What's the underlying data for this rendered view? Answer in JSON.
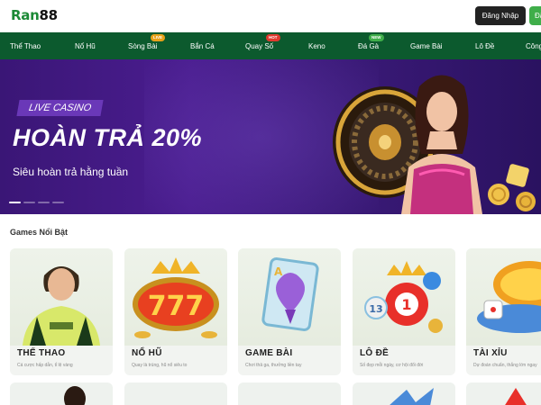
{
  "header": {
    "logo_text": "Ran",
    "logo_num": "88",
    "login_label": "Đăng Nhập",
    "register_label": "Đăng Ký"
  },
  "nav": {
    "items": [
      {
        "label": "Thể Thao",
        "badge": null
      },
      {
        "label": "Nổ Hũ",
        "badge": null
      },
      {
        "label": "Sòng Bài",
        "badge": "LIVE"
      },
      {
        "label": "Bắn Cá",
        "badge": null
      },
      {
        "label": "Quay Số",
        "badge": "HOT"
      },
      {
        "label": "Keno",
        "badge": null
      },
      {
        "label": "Đá Gà",
        "badge": "NEW"
      },
      {
        "label": "Game Bài",
        "badge": null
      },
      {
        "label": "Lô Đề",
        "badge": null
      },
      {
        "label": "Công",
        "badge": null
      }
    ]
  },
  "banner": {
    "tag": "LIVE CASINO",
    "title": "HOÀN TRẢ 20%",
    "subtitle": "Siêu hoàn trả hằng tuần",
    "slide_count": 4,
    "active_slide": 1
  },
  "section": {
    "title": "Games Nổi Bật"
  },
  "games": [
    {
      "name": "THỂ THAO",
      "desc": "Cá cược hấp dẫn, tỉ lệ vàng",
      "icon": "soccer-player-icon"
    },
    {
      "name": "NỔ HŨ",
      "desc": "Quay là trúng, hũ nổ siêu to",
      "icon": "slot-777-icon"
    },
    {
      "name": "GAME BÀI",
      "desc": "Chơi thả ga, thưởng liền tay",
      "icon": "playing-card-icon"
    },
    {
      "name": "LÔ ĐỀ",
      "desc": "Số đẹp mỗi ngày, cơ hội đổi đời",
      "icon": "lottery-ball-icon"
    },
    {
      "name": "TÀI XỈU",
      "desc": "Dự đoán chuẩn, thắng lớn ngay",
      "icon": "dice-icon"
    }
  ],
  "colors": {
    "brand_green": "#1c8a36",
    "nav_bg": "#0c5a2e",
    "banner_purple": "#4a1d8f",
    "live_badge": "#e8a21a",
    "hot_badge": "#e03a2f",
    "new_badge": "#3fae4a"
  }
}
